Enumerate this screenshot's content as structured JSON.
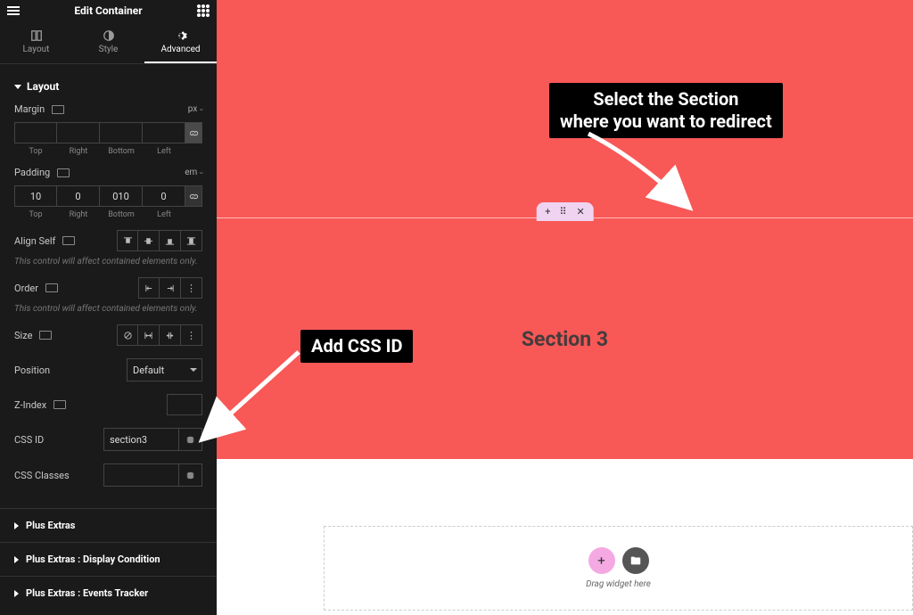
{
  "header": {
    "title": "Edit Container"
  },
  "tabs": {
    "layout": "Layout",
    "style": "Style",
    "advanced": "Advanced"
  },
  "layout_section_title": "Layout",
  "margin": {
    "label": "Margin",
    "unit": "px",
    "sub": {
      "top": "Top",
      "right": "Right",
      "bottom": "Bottom",
      "left": "Left"
    }
  },
  "padding": {
    "label": "Padding",
    "unit": "em",
    "values": {
      "top": "10",
      "right": "0",
      "bottom": "010",
      "left": "0"
    },
    "sub": {
      "top": "Top",
      "right": "Right",
      "bottom": "Bottom",
      "left": "Left"
    }
  },
  "align_self_label": "Align Self",
  "hint1": "This control will affect contained elements only.",
  "order_label": "Order",
  "hint2": "This control will affect contained elements only.",
  "size_label": "Size",
  "position_label": "Position",
  "position_value": "Default",
  "zindex_label": "Z-Index",
  "cssid_label": "CSS ID",
  "cssid_value": "section3",
  "cssclasses_label": "CSS Classes",
  "accordions": {
    "extras": "Plus Extras",
    "display": "Plus Extras : Display Condition",
    "events": "Plus Extras : Events Tracker"
  },
  "canvas": {
    "section3_title": "Section 3",
    "drag_label": "Drag widget here"
  },
  "annotations": {
    "select_section": "Select the Section\nwhere you want to redirect",
    "add_css_id": "Add CSS ID"
  }
}
